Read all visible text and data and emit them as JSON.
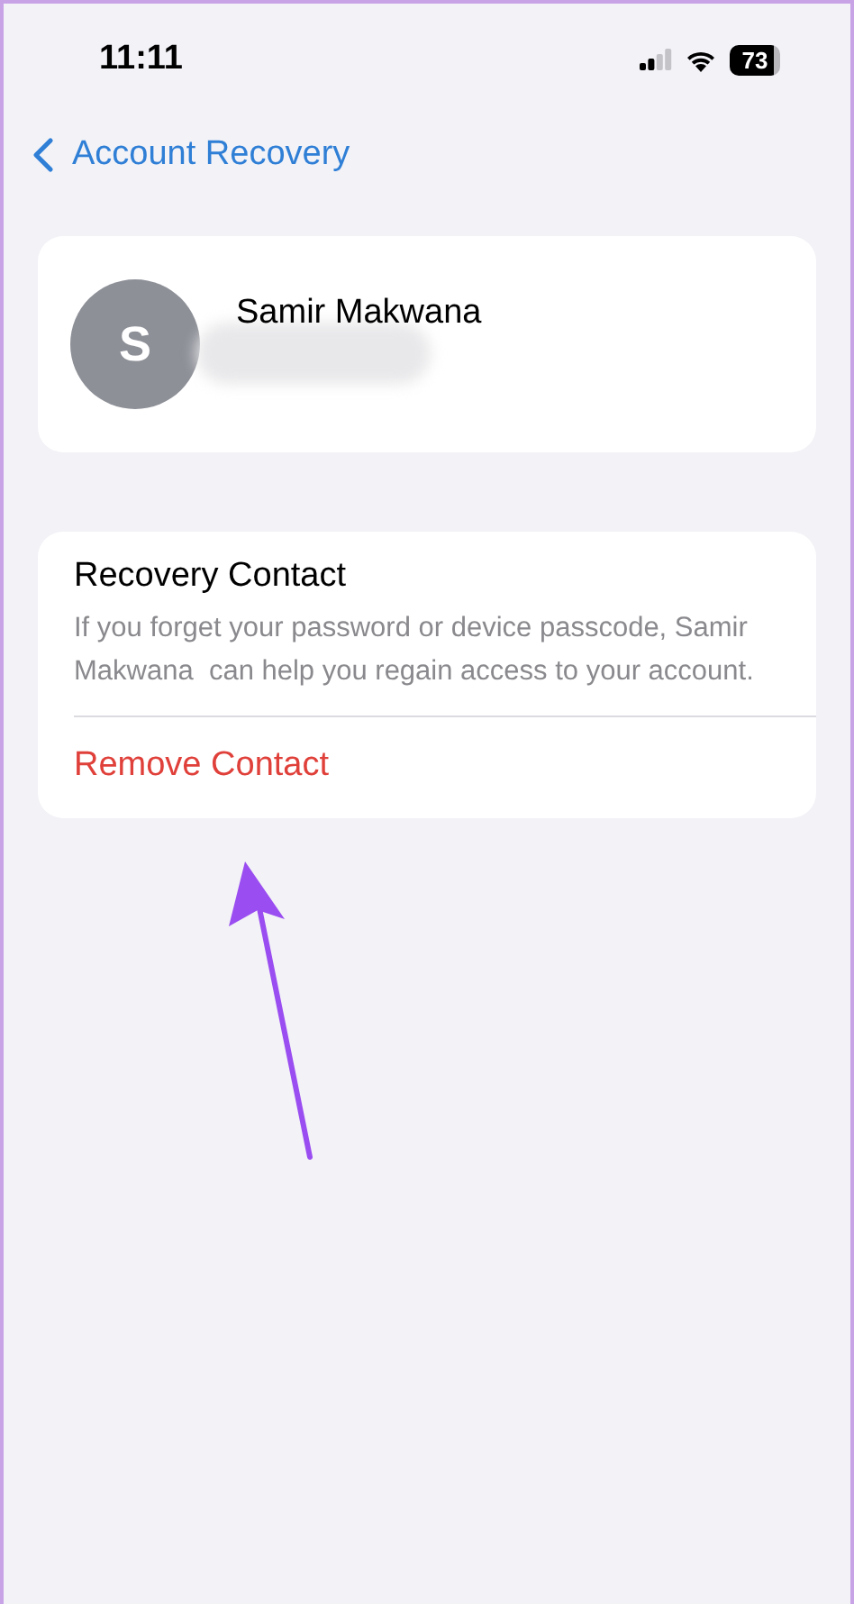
{
  "status_bar": {
    "time": "11:11",
    "battery": "73"
  },
  "nav": {
    "back_label": "Account Recovery"
  },
  "contact": {
    "initial": "S",
    "name": "Samir Makwana",
    "detail_redacted": true
  },
  "recovery_section": {
    "title": "Recovery Contact",
    "description": "If you forget your password or device passcode, Samir Makwana  can help you regain access to your account.",
    "action": "Remove Contact"
  },
  "annotation": {
    "kind": "arrow"
  }
}
